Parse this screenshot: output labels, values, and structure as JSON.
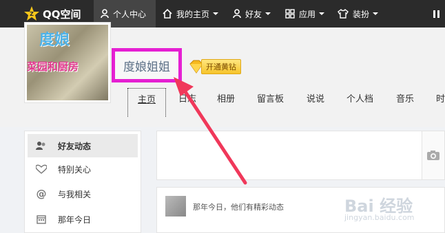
{
  "topbar": {
    "logo_text": "QQ空间",
    "items": [
      {
        "label": "个人中心",
        "icon": "person-icon"
      },
      {
        "label": "我的主页",
        "icon": "home-icon"
      },
      {
        "label": "好友",
        "icon": "friends-icon"
      },
      {
        "label": "应用",
        "icon": "apps-icon"
      },
      {
        "label": "装扮",
        "icon": "shirt-icon"
      }
    ]
  },
  "profile": {
    "avatar_title": "度娘",
    "avatar_sub": "菜园和厨房",
    "name": "度娘姐姐",
    "vip_label": "开通黄钻"
  },
  "tabs": [
    "主页",
    "日志",
    "相册",
    "留言板",
    "说说",
    "个人档",
    "音乐",
    "时"
  ],
  "leftnav": {
    "items": [
      {
        "label": "好友动态",
        "icon": "feed-icon"
      },
      {
        "label": "特别关心",
        "icon": "heart-icon"
      },
      {
        "label": "与我相关",
        "icon": "at-icon"
      },
      {
        "label": "那年今日",
        "icon": "calendar-icon"
      }
    ]
  },
  "feed": {
    "text": "那年今日，他们有精彩动态"
  },
  "watermark": {
    "main": "Bai 经验",
    "sub": "jingyan.baidu.com"
  },
  "colors": {
    "highlight_box": "#e51fd2",
    "arrow": "#f0385a",
    "topbar": "#2b2b2b"
  }
}
